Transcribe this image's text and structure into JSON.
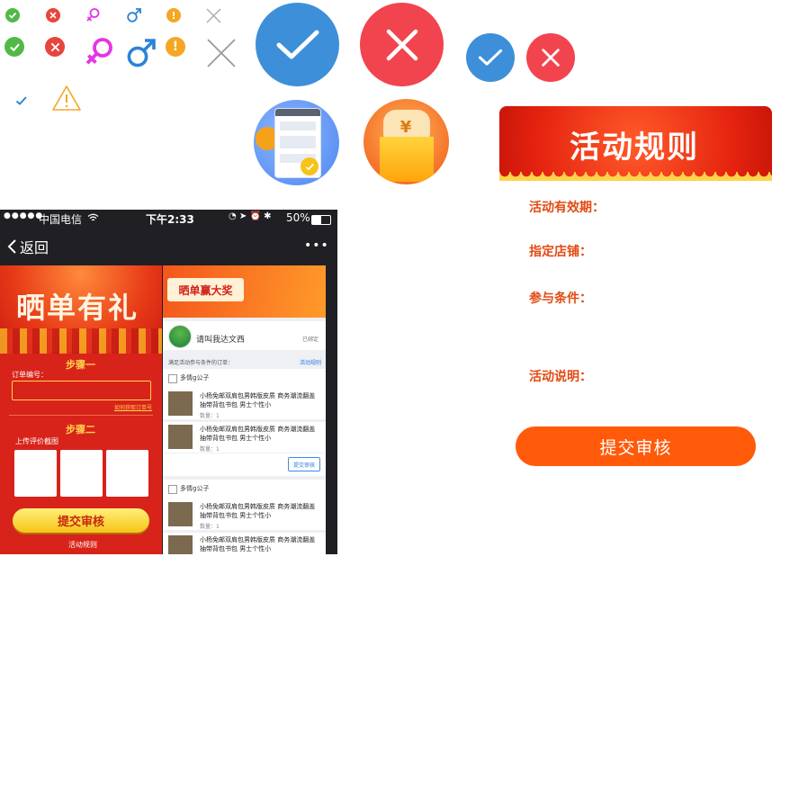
{
  "colors": {
    "blue": "#3d8fd9",
    "red": "#f2444e",
    "green": "#52b848",
    "orange": "#f5a623",
    "magenta": "#e534e5",
    "rule_orange": "#ff5a0a"
  },
  "icons": {
    "small_row": [
      "check-circle-icon",
      "close-circle-icon",
      "female-icon",
      "male-icon",
      "exclamation-icon",
      "x-icon"
    ],
    "medium_row": [
      "check-circle-icon",
      "close-circle-icon",
      "female-icon",
      "male-icon",
      "exclamation-icon",
      "x-icon"
    ],
    "misc": [
      "checkmark-icon",
      "warning-triangle-icon"
    ]
  },
  "phone": {
    "carrier": "中国电信",
    "time": "下午2:33",
    "battery": "50%",
    "back_label": "返回",
    "more_label": "•••"
  },
  "left_page": {
    "banner_title": "晒单有礼",
    "step1_label": "步骤一",
    "order_no_label": "订单编号：",
    "order_no_value": "",
    "how_to_get_link": "如何获取订单号",
    "step2_label": "步骤二",
    "upload_label": "上传评价截图",
    "submit_label": "提交审核",
    "rules_link": "活动规则"
  },
  "right_page": {
    "banner_title": "晒单赢大奖",
    "user_name": "请叫我达文西",
    "bind_status": "已绑定",
    "eligible_label": "满足活动参与条件的订单：",
    "rules_link": "活动规则",
    "shop_name": "多情g公子",
    "submit_button": "提交审核",
    "shop_name_2": "多情g公子",
    "goods": [
      {
        "title": "小杨免邮双肩包男韩版皮质 商务潮流翻盖抽带背包书包 男士个性小",
        "qty": "数量：1"
      },
      {
        "title": "小杨免邮双肩包男韩版皮质 商务潮流翻盖抽带背包书包 男士个性小",
        "qty": "数量：1"
      },
      {
        "title": "小杨免邮双肩包男韩版皮质 商务潮流翻盖抽带背包书包 男士个性小",
        "qty": "数量：1"
      },
      {
        "title": "小杨免邮双肩包男韩版皮质 商务潮流翻盖抽带背包书包 男士个性小",
        "qty": ""
      }
    ]
  },
  "rules": {
    "banner_title": "活动规则",
    "validity_label": "活动有效期：",
    "store_label": "指定店铺：",
    "condition_label": "参与条件：",
    "desc_label": "活动说明：",
    "submit_label": "提交审核"
  }
}
